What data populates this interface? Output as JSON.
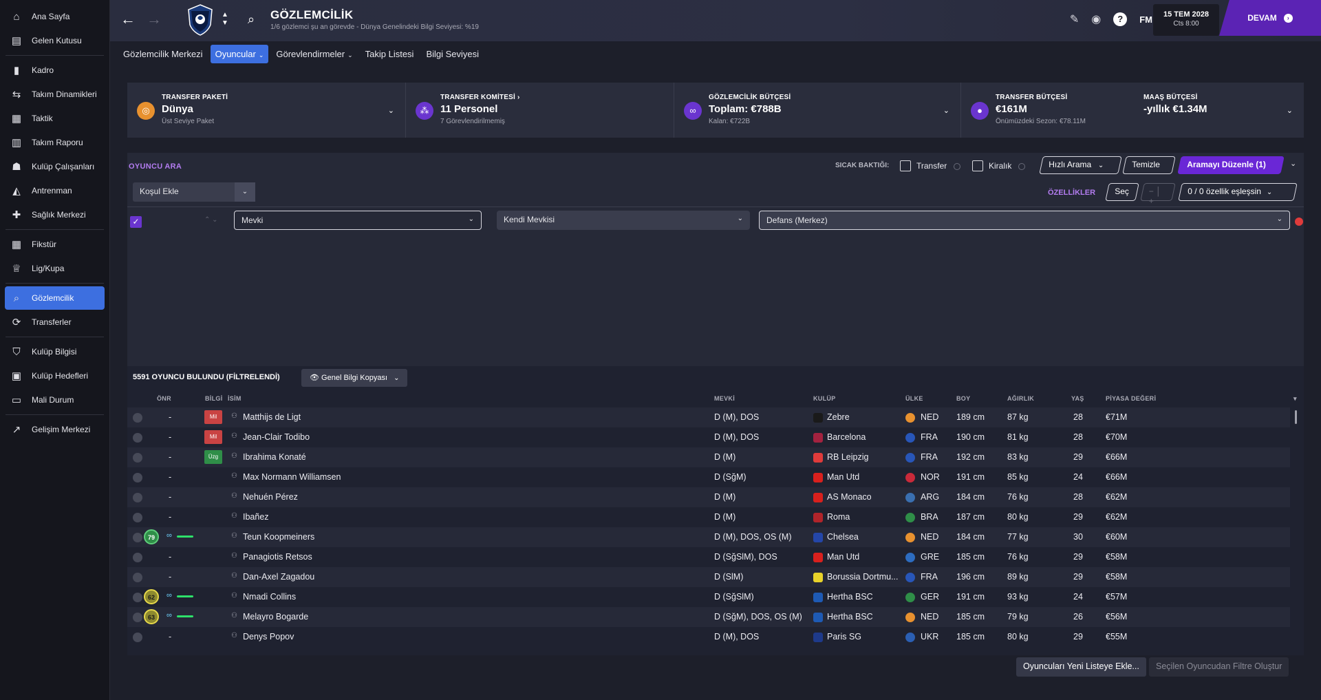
{
  "sidebar": {
    "items": [
      {
        "label": "Ana Sayfa",
        "icon": "home-icon"
      },
      {
        "label": "Gelen Kutusu",
        "icon": "inbox-icon"
      },
      {
        "label": "Kadro",
        "icon": "shirt-icon"
      },
      {
        "label": "Takım Dinamikleri",
        "icon": "dynamics-icon"
      },
      {
        "label": "Taktik",
        "icon": "tactics-icon"
      },
      {
        "label": "Takım Raporu",
        "icon": "report-icon"
      },
      {
        "label": "Kulüp Çalışanları",
        "icon": "staff-icon"
      },
      {
        "label": "Antrenman",
        "icon": "training-icon"
      },
      {
        "label": "Sağlık Merkezi",
        "icon": "medical-icon"
      },
      {
        "label": "Fikstür",
        "icon": "calendar-icon"
      },
      {
        "label": "Lig/Kupa",
        "icon": "trophy-icon"
      },
      {
        "label": "Gözlemcilik",
        "icon": "search-icon"
      },
      {
        "label": "Transferler",
        "icon": "transfer-icon"
      },
      {
        "label": "Kulüp Bilgisi",
        "icon": "shield-icon"
      },
      {
        "label": "Kulüp Hedefleri",
        "icon": "briefcase-icon"
      },
      {
        "label": "Mali Durum",
        "icon": "finance-icon"
      },
      {
        "label": "Gelişim Merkezi",
        "icon": "development-icon"
      }
    ],
    "active_index": 11
  },
  "header": {
    "title": "GÖZLEMCİLİK",
    "subtitle": "1/6 gözlemci şu an görevde - Dünya Genelindeki Bilgi Seviyesi: %19",
    "fm_label": "FM",
    "date": "15 TEM 2028",
    "time": "Cts 8:00",
    "continue_label": "DEVAM"
  },
  "tabs": [
    {
      "label": "Gözlemcilik Merkezi",
      "active": false,
      "dropdown": false
    },
    {
      "label": "Oyuncular",
      "active": true,
      "dropdown": true
    },
    {
      "label": "Görevlendirmeler",
      "active": false,
      "dropdown": true
    },
    {
      "label": "Takip Listesi",
      "active": false,
      "dropdown": false
    },
    {
      "label": "Bilgi Seviyesi",
      "active": false,
      "dropdown": false
    }
  ],
  "budget": {
    "package": {
      "head": "TRANSFER PAKETİ",
      "main": "Dünya",
      "sub": "Üst Seviye Paket"
    },
    "committee": {
      "head": "TRANSFER KOMİTESİ",
      "main": "11 Personel",
      "sub": "7 Görevlendirilmemiş"
    },
    "scouting": {
      "head": "GÖZLEMCİLİK BÜTÇESİ",
      "main": "Toplam: €788B",
      "sub": "Kalan: €722B"
    },
    "transfer": {
      "head": "TRANSFER BÜTÇESİ",
      "main": "€161M",
      "sub": "Önümüzdeki Sezon: €78.11M"
    },
    "wage": {
      "head": "MAAŞ BÜTÇESİ",
      "main": "-yıllık €1.34M"
    }
  },
  "search": {
    "title": "OYUNCU ARA",
    "hot_label": "SICAK BAKTIĞI:",
    "transfer_label": "Transfer",
    "loan_label": "Kiralık",
    "quick_search": "Hızlı Arama",
    "clear": "Temizle",
    "edit_search": "Aramayı Düzenle (1)",
    "add_condition": "Koşul Ekle",
    "attributes_label": "ÖZELLİKLER",
    "select_label": "Seç",
    "attr_match": "0 / 0 özellik eşleşsin",
    "criterion": {
      "field": "Mevki",
      "mode": "Kendi Mevkisi",
      "value": "Defans (Merkez)"
    }
  },
  "results": {
    "count_label": "5591 OYUNCU BULUNDU (FİLTRELENDİ)",
    "view_label": "Genel Bilgi Kopyası",
    "columns": {
      "onr": "ÖNR",
      "bilgi": "BİLGİ",
      "isim": "İSİM",
      "mevki": "MEVKİ",
      "kulup": "KULÜP",
      "ulke": "ÜLKE",
      "boy": "BOY",
      "agirlik": "AĞIRLIK",
      "yas": "YAŞ",
      "deger": "PİYASA DEĞERİ"
    },
    "rows": [
      {
        "onr": "-",
        "badge": "Mil",
        "badge_color": "#c94343",
        "name": "Matthijs de Ligt",
        "pos": "D (M), DOS",
        "club": "Zebre",
        "club_color": "#1a1a1a",
        "nat": "NED",
        "nat_color": "#e8912f",
        "height": "189 cm",
        "weight": "87 kg",
        "age": "28",
        "value": "€71M"
      },
      {
        "onr": "-",
        "badge": "Mil",
        "badge_color": "#c94343",
        "name": "Jean-Clair Todibo",
        "pos": "D (M), DOS",
        "club": "Barcelona",
        "club_color": "#a3223f",
        "nat": "FRA",
        "nat_color": "#2856b8",
        "height": "190 cm",
        "weight": "81 kg",
        "age": "28",
        "value": "€70M"
      },
      {
        "onr": "-",
        "badge": "Üzg",
        "badge_color": "#2f8e48",
        "name": "Ibrahima Konaté",
        "pos": "D (M)",
        "club": "RB Leipzig",
        "club_color": "#e03b3b",
        "nat": "FRA",
        "nat_color": "#2856b8",
        "height": "192 cm",
        "weight": "83 kg",
        "age": "29",
        "value": "€66M"
      },
      {
        "onr": "-",
        "name": "Max Normann Williamsen",
        "pos": "D (SğM)",
        "club": "Man Utd",
        "club_color": "#d8201d",
        "nat": "NOR",
        "nat_color": "#c92a3a",
        "height": "191 cm",
        "weight": "85 kg",
        "age": "24",
        "value": "€66M"
      },
      {
        "onr": "-",
        "name": "Nehuén Pérez",
        "pos": "D (M)",
        "club": "AS Monaco",
        "club_color": "#d8201d",
        "nat": "ARG",
        "nat_color": "#3a6fb0",
        "height": "184 cm",
        "weight": "76 kg",
        "age": "28",
        "value": "€62M"
      },
      {
        "onr": "-",
        "name": "Ibañez",
        "pos": "D (M)",
        "club": "Roma",
        "club_color": "#b0242a",
        "nat": "BRA",
        "nat_color": "#2f8e48",
        "height": "187 cm",
        "weight": "80 kg",
        "age": "29",
        "value": "€62M"
      },
      {
        "onr": "79",
        "ability": "green",
        "scouted": true,
        "name": "Teun Koopmeiners",
        "pos": "D (M), DOS, OS (M)",
        "club": "Chelsea",
        "club_color": "#2446a8",
        "nat": "NED",
        "nat_color": "#e8912f",
        "height": "184 cm",
        "weight": "77 kg",
        "age": "30",
        "value": "€60M"
      },
      {
        "onr": "-",
        "name": "Panagiotis Retsos",
        "pos": "D (SğSlM), DOS",
        "club": "Man Utd",
        "club_color": "#d8201d",
        "nat": "GRE",
        "nat_color": "#2d6cc0",
        "height": "185 cm",
        "weight": "76 kg",
        "age": "29",
        "value": "€58M"
      },
      {
        "onr": "-",
        "name": "Dan-Axel Zagadou",
        "pos": "D (SlM)",
        "club": "Borussia Dortmu...",
        "club_color": "#e8d22a",
        "nat": "FRA",
        "nat_color": "#2856b8",
        "height": "196 cm",
        "weight": "89 kg",
        "age": "29",
        "value": "€58M"
      },
      {
        "onr": "62",
        "ability": "yellow",
        "scouted": true,
        "name": "Nmadi Collins",
        "pos": "D (SğSlM)",
        "club": "Hertha BSC",
        "club_color": "#1e5ab4",
        "nat": "GER",
        "nat_color": "#2f8e48",
        "height": "191 cm",
        "weight": "93 kg",
        "age": "24",
        "value": "€57M"
      },
      {
        "onr": "63",
        "ability": "yellow",
        "scouted": true,
        "name": "Melayro Bogarde",
        "pos": "D (SğM), DOS, OS (M)",
        "club": "Hertha BSC",
        "club_color": "#1e5ab4",
        "nat": "NED",
        "nat_color": "#e8912f",
        "height": "185 cm",
        "weight": "79 kg",
        "age": "26",
        "value": "€56M"
      },
      {
        "onr": "-",
        "name": "Denys Popov",
        "pos": "D (M), DOS",
        "club": "Paris SG",
        "club_color": "#1e3a8a",
        "nat": "UKR",
        "nat_color": "#2b5fb3",
        "height": "185 cm",
        "weight": "80 kg",
        "age": "29",
        "value": "€55M"
      }
    ]
  },
  "footer": {
    "add_to_list": "Oyuncuları Yeni Listeye Ekle...",
    "create_filter": "Seçilen Oyuncudan Filtre Oluştur"
  }
}
